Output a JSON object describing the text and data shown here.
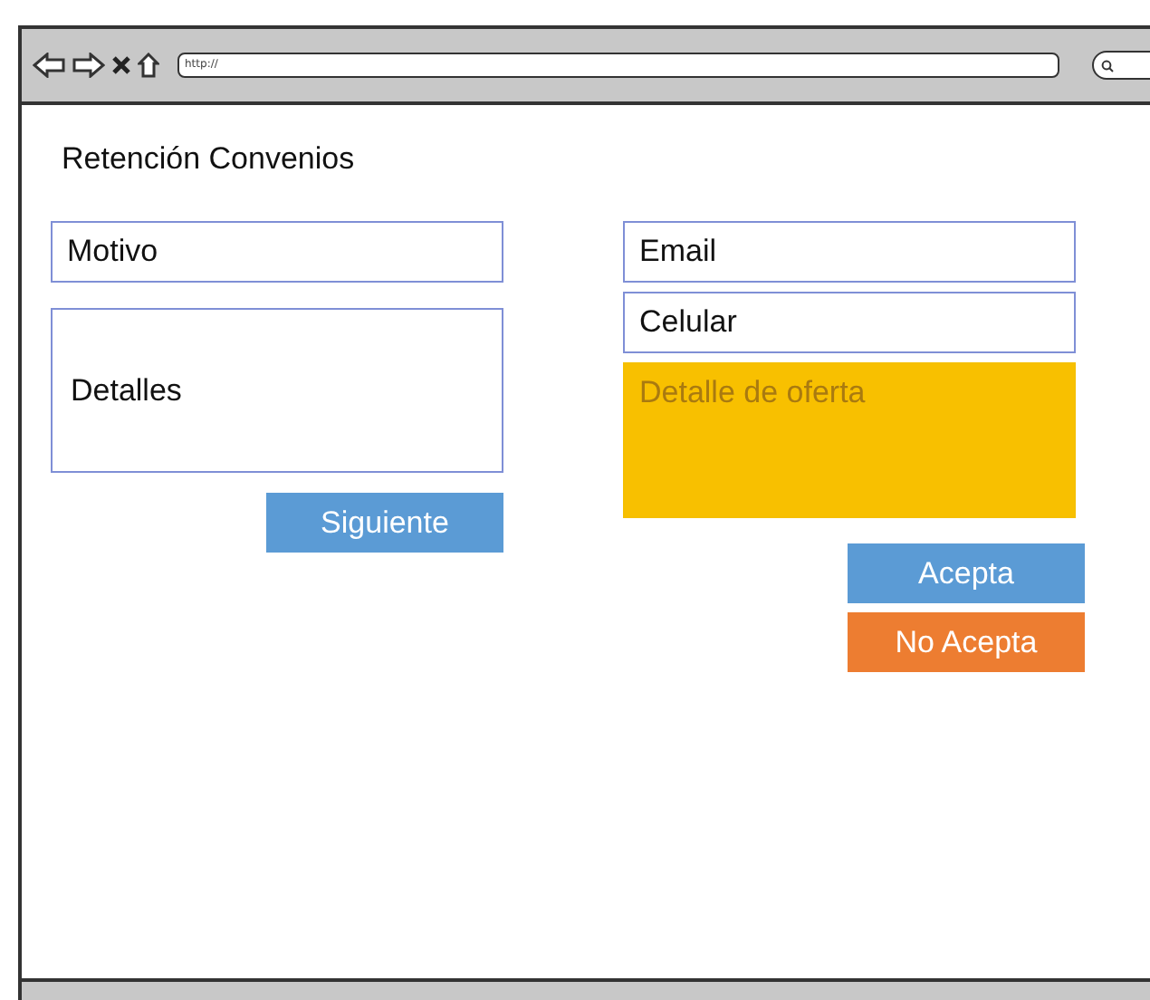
{
  "browser": {
    "url": "http://"
  },
  "title": "Retención Convenios",
  "left_fields": [
    {
      "label": "Motivo",
      "kind": "line"
    },
    {
      "label": "Detalles",
      "kind": "area"
    }
  ],
  "left_button": {
    "label": "Siguiente",
    "color": "#5b9bd5"
  },
  "right_fields": [
    {
      "label": "Email",
      "kind": "line"
    },
    {
      "label": "Celular",
      "kind": "line"
    },
    {
      "label": "Detalle de oferta",
      "kind": "offer"
    }
  ],
  "right_buttons": [
    {
      "label": "Acepta",
      "color": "#5b9bd5"
    },
    {
      "label": "No Acepta",
      "color": "#ed7d31"
    }
  ]
}
